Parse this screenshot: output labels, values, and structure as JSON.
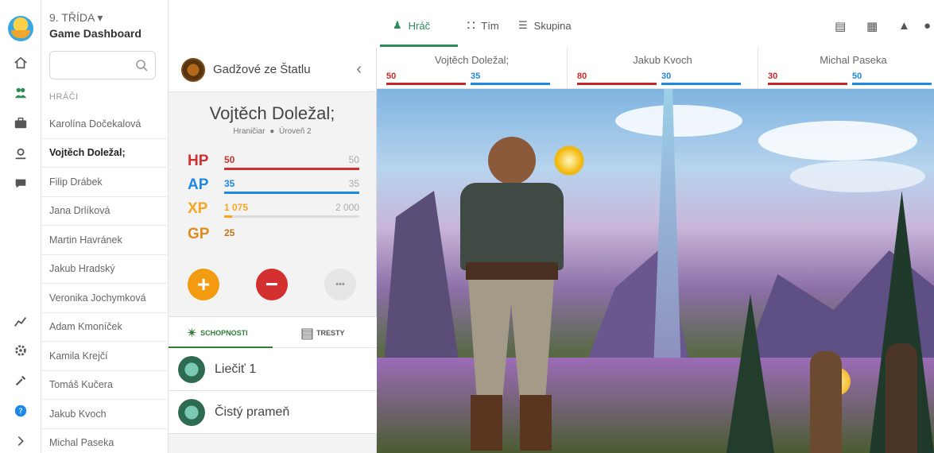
{
  "app": {
    "class_label": "9. TŘÍDA ▾",
    "title": "Game Dashboard"
  },
  "search": {
    "placeholder": ""
  },
  "sidebar": {
    "section_label": "HRÁČI",
    "players": [
      "Karolína Dočekalová",
      "Vojtěch Doležal;",
      "Filip Drábek",
      "Jana Drlíková",
      "Martin Havránek",
      "Jakub Hradský",
      "Veronika Jochymková",
      "Adam Kmoníček",
      "Kamila Krejčí",
      "Tomáš Kučera",
      "Jakub Kvoch",
      "Michal Paseka"
    ],
    "active_index": 1
  },
  "nav": {
    "tabs": [
      {
        "label": "Hráč",
        "icon": "players-icon"
      },
      {
        "label": "Tím",
        "icon": "shield-icon"
      },
      {
        "label": "Skupina",
        "icon": "list-icon"
      }
    ],
    "active_tab": 0
  },
  "party": [
    {
      "name": "Vojtěch Doležal;",
      "hp": "50",
      "ap": "35"
    },
    {
      "name": "Jakub Kvoch",
      "hp": "80",
      "ap": "30"
    },
    {
      "name": "Michal Paseka",
      "hp": "30",
      "ap": "50"
    }
  ],
  "character": {
    "group": "Gadžové ze Štatlu",
    "name": "Vojtěch Doležal;",
    "class": "Hraničiar",
    "level": "Úroveň 2",
    "stats": {
      "hp": {
        "label": "HP",
        "value": "50",
        "max": "50",
        "fill": 1.0,
        "color": "#d32f2f"
      },
      "ap": {
        "label": "AP",
        "value": "35",
        "max": "35",
        "fill": 1.0,
        "color": "#1e88e5"
      },
      "xp": {
        "label": "XP",
        "value": "1 075",
        "max": "2 000",
        "fill": 0.06,
        "color": "#f5a623"
      },
      "gp": {
        "label": "GP",
        "value": "25",
        "color": "#e08b1e"
      }
    },
    "actions": {
      "add_symbol": "+",
      "remove_symbol": "−",
      "more_symbol": "•••"
    },
    "tabs": [
      {
        "label": "SCHOPNOSTI"
      },
      {
        "label": "TRESTY"
      }
    ],
    "skills": [
      {
        "name": "Liečiť 1"
      },
      {
        "name": "Čistý prameň"
      }
    ]
  },
  "colors": {
    "accent": "#2e8b57",
    "hp": "#c62828",
    "ap": "#1e88e5",
    "xp": "#f5a623",
    "add_button": "#f39c12",
    "remove_button": "#d32f2f"
  }
}
